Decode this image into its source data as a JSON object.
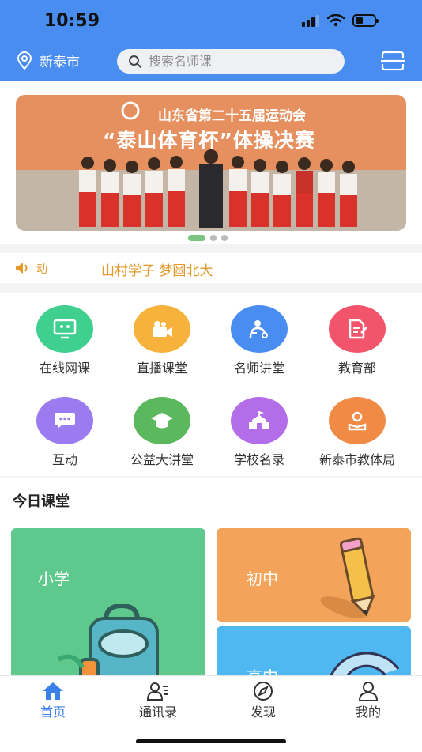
{
  "status": {
    "time": "10:59"
  },
  "header": {
    "city": "新泰市",
    "search_placeholder": "搜索名师课"
  },
  "banner": {
    "title": "山东省第二十五届运动会",
    "subtitle": "“泰山体育杯”体操决赛",
    "dots": 3,
    "active_dot": 0
  },
  "notice": {
    "text": "山村学子 梦圆北大",
    "prefix": "动"
  },
  "grid": {
    "items": [
      {
        "label": "在线网课",
        "color": "#3fcf8e",
        "icon": "monitor-icon"
      },
      {
        "label": "直播课堂",
        "color": "#f7b23b",
        "icon": "camera-icon"
      },
      {
        "label": "名师讲堂",
        "color": "#4a8df0",
        "icon": "teacher-icon"
      },
      {
        "label": "教育部",
        "color": "#f2556b",
        "icon": "document-icon"
      },
      {
        "label": "互动",
        "color": "#9a7cf0",
        "icon": "chat-icon"
      },
      {
        "label": "公益大讲堂",
        "color": "#5cb85c",
        "icon": "graduation-cap-icon"
      },
      {
        "label": "学校名录",
        "color": "#b46de8",
        "icon": "school-icon"
      },
      {
        "label": "新泰市教体局",
        "color": "#f08a45",
        "icon": "reader-icon"
      }
    ]
  },
  "today": {
    "title": "今日课堂",
    "cards": [
      {
        "label": "小学",
        "color": "#5fc98d"
      },
      {
        "label": "初中",
        "color": "#f4a45a"
      },
      {
        "label": "高中",
        "color": "#4fb8f0"
      }
    ]
  },
  "tabbar": {
    "items": [
      {
        "label": "首页",
        "active": true,
        "icon": "home-icon"
      },
      {
        "label": "通讯录",
        "active": false,
        "icon": "contacts-icon"
      },
      {
        "label": "发现",
        "active": false,
        "icon": "compass-icon"
      },
      {
        "label": "我的",
        "active": false,
        "icon": "user-icon"
      }
    ]
  }
}
